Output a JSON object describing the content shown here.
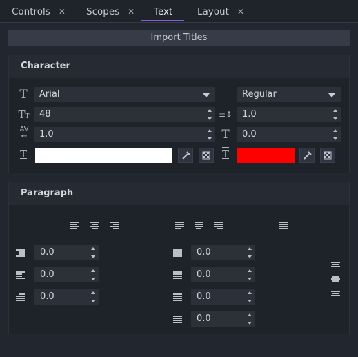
{
  "tabs": [
    {
      "label": "Controls",
      "close": "✕"
    },
    {
      "label": "Scopes",
      "close": "✕"
    },
    {
      "label": "Text"
    },
    {
      "label": "Layout",
      "close": "✕"
    }
  ],
  "import_button": "Import Titles",
  "character": {
    "title": "Character",
    "font": "Arial",
    "style": "Regular",
    "size": "48",
    "line_spacing": "1.0",
    "char_spacing": "1.0",
    "baseline": "0.0",
    "fill_color": "#ffffff",
    "outline_color": "#ff0000"
  },
  "paragraph": {
    "title": "Paragraph",
    "indent_left": "0.0",
    "indent_right": "0.0",
    "indent_first": "0.0",
    "space_before": "0.0",
    "space_after": "0.0",
    "space_line": "0.0",
    "space_extra": "0.0"
  },
  "colors": {
    "accent": "#7b61d8"
  }
}
